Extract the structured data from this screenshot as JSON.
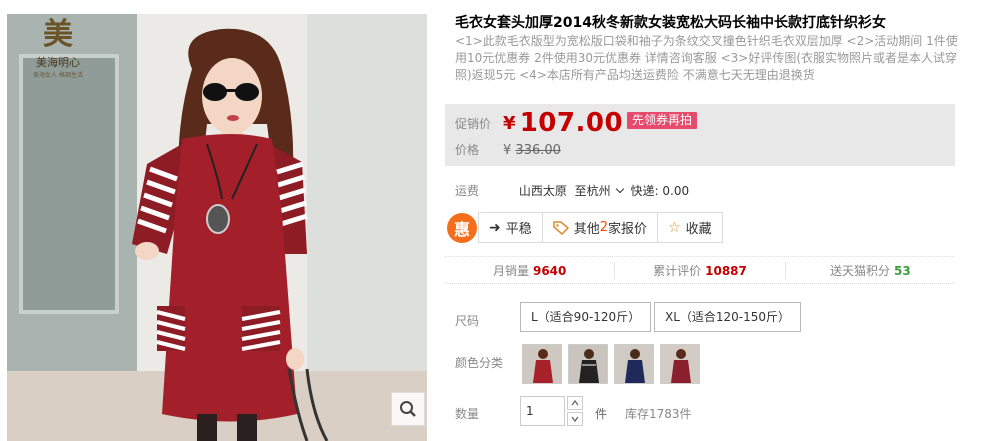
{
  "gallery": {
    "logo": {
      "mark": "美",
      "name": "美海明心",
      "slogan": "美海女人 格調生活"
    }
  },
  "product": {
    "title": "毛衣女套头加厚2014秋冬新款女装宽松大码长袖中长款打底针织衫女",
    "subtitle": "<1>此款毛衣版型为宽松版口袋和袖子为条纹交叉撞色针织毛衣双层加厚 <2>活动期间 1件使用10元优惠券 2件使用30元优惠券 详情咨询客服 <3>好评传图(衣服实物照片或者是本人试穿照)返现5元 <4>本店所有产品均送运费险 不满意七天无理由退换货"
  },
  "price": {
    "promo_label": "促销价",
    "currency": "¥",
    "promo_value": "107.00",
    "coupon_tag": "先领券再拍",
    "orig_label": "价格",
    "orig_value": "336.00"
  },
  "shipping": {
    "label": "运费",
    "from": "山西太原",
    "to": "至杭州",
    "method": "快递: 0.00"
  },
  "services": {
    "hui_icon": "惠",
    "pingwen": "平稳",
    "other_quotes_prefix": "其他",
    "other_quotes_count": "2",
    "other_quotes_suffix": "家报价",
    "favorite": "收藏"
  },
  "stats": {
    "monthly_sales_label": "月销量",
    "monthly_sales": "9640",
    "reviews_label": "累计评价",
    "reviews": "10887",
    "points_label": "送天猫积分",
    "points": "53"
  },
  "options": {
    "size_label": "尺码",
    "sizes": [
      "L（适合90-120斤）",
      "XL（适合120-150斤）"
    ],
    "color_label": "颜色分类",
    "colors": [
      {
        "icon": "red-dress-swatch",
        "bg": "#a8202a"
      },
      {
        "icon": "black-dress-swatch",
        "bg": "#222"
      },
      {
        "icon": "navy-dress-swatch",
        "bg": "#1f2a5a"
      },
      {
        "icon": "wine-dress-swatch",
        "bg": "#8a1f2e"
      }
    ],
    "qty_label": "数量",
    "qty_value": "1",
    "qty_unit": "件",
    "stock": "库存1783件"
  },
  "colors": {
    "price_red": "#c40000",
    "coupon_pink": "#e64b6e",
    "hui_orange": "#f46e1b",
    "points_green": "#3c9c3c"
  }
}
